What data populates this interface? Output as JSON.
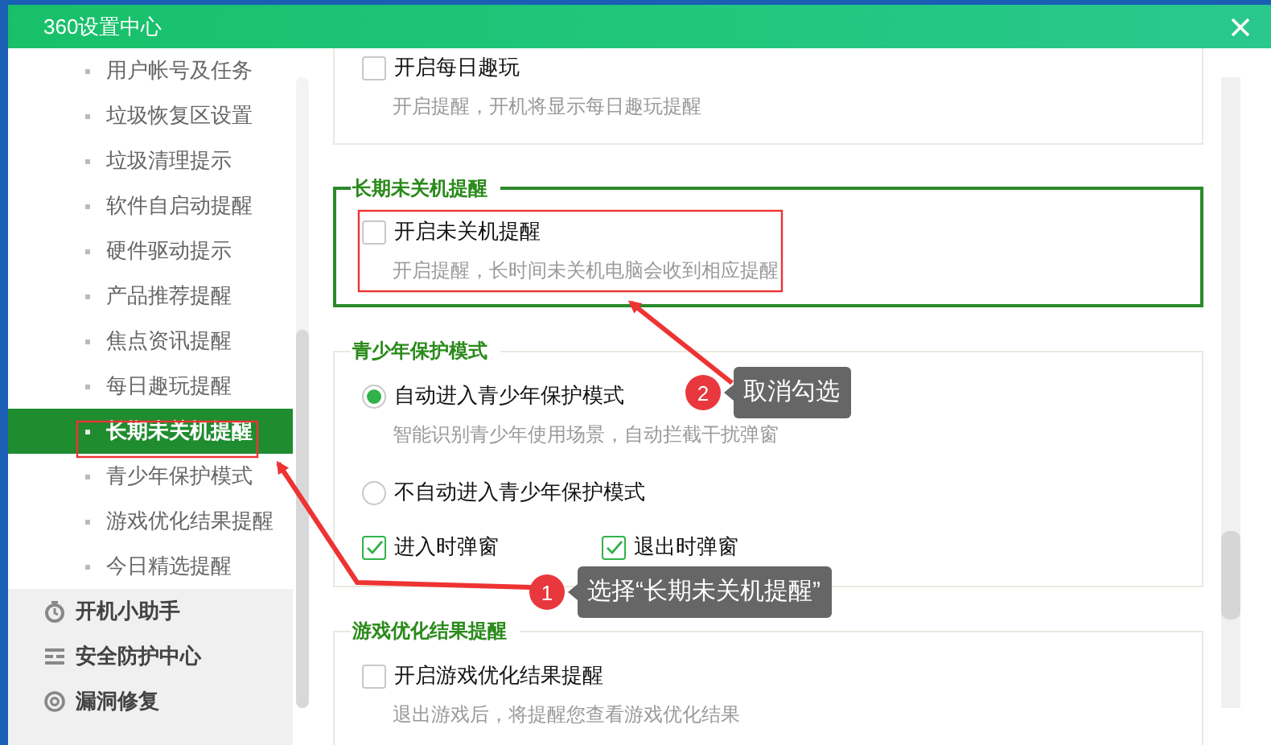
{
  "window": {
    "title": "360设置中心"
  },
  "sidebar": {
    "items": [
      {
        "kind": "sub",
        "label": "用户帐号及任务",
        "selected": false
      },
      {
        "kind": "sub",
        "label": "垃圾恢复区设置",
        "selected": false
      },
      {
        "kind": "sub",
        "label": "垃圾清理提示",
        "selected": false
      },
      {
        "kind": "sub",
        "label": "软件自启动提醒",
        "selected": false
      },
      {
        "kind": "sub",
        "label": "硬件驱动提示",
        "selected": false
      },
      {
        "kind": "sub",
        "label": "产品推荐提醒",
        "selected": false
      },
      {
        "kind": "sub",
        "label": "焦点资讯提醒",
        "selected": false
      },
      {
        "kind": "sub",
        "label": "每日趣玩提醒",
        "selected": false
      },
      {
        "kind": "sub",
        "label": "长期未关机提醒",
        "selected": true
      },
      {
        "kind": "sub",
        "label": "青少年保护模式",
        "selected": false
      },
      {
        "kind": "sub",
        "label": "游戏优化结果提醒",
        "selected": false
      },
      {
        "kind": "sub",
        "label": "今日精选提醒",
        "selected": false
      },
      {
        "kind": "group",
        "label": "开机小助手",
        "selected": false
      },
      {
        "kind": "group",
        "label": "安全防护中心",
        "selected": false
      },
      {
        "kind": "group",
        "label": "漏洞修复",
        "selected": false
      }
    ]
  },
  "sections": [
    {
      "active": false,
      "items": [
        {
          "kind": "checkbox",
          "label": "开启每日趣玩",
          "checked": false,
          "description": "开启提醒，开机将显示每日趣玩提醒"
        }
      ]
    },
    {
      "title": "长期未关机提醒",
      "active": true,
      "items": [
        {
          "kind": "checkbox",
          "label": "开启未关机提醒",
          "checked": false,
          "description": "开启提醒，长时间未关机电脑会收到相应提醒"
        }
      ]
    },
    {
      "title": "青少年保护模式",
      "active": false,
      "items": [
        {
          "kind": "radio",
          "label": "自动进入青少年保护模式",
          "selected": true,
          "description": "智能识别青少年使用场景，自动拦截干扰弹窗"
        },
        {
          "kind": "radio",
          "label": "不自动进入青少年保护模式",
          "selected": false
        },
        {
          "kind": "checkbox_pair",
          "options": [
            {
              "label": "进入时弹窗",
              "checked": true
            },
            {
              "label": "退出时弹窗",
              "checked": true
            }
          ]
        }
      ]
    },
    {
      "title": "游戏优化结果提醒",
      "active": false,
      "items": [
        {
          "kind": "checkbox",
          "label": "开启游戏优化结果提醒",
          "checked": false,
          "description": "退出游戏后，将提醒您查看游戏优化结果"
        }
      ]
    }
  ],
  "annotations": [
    {
      "number": "2",
      "text": "取消勾选"
    },
    {
      "number": "1",
      "text": "选择“长期未关机提醒”"
    }
  ]
}
